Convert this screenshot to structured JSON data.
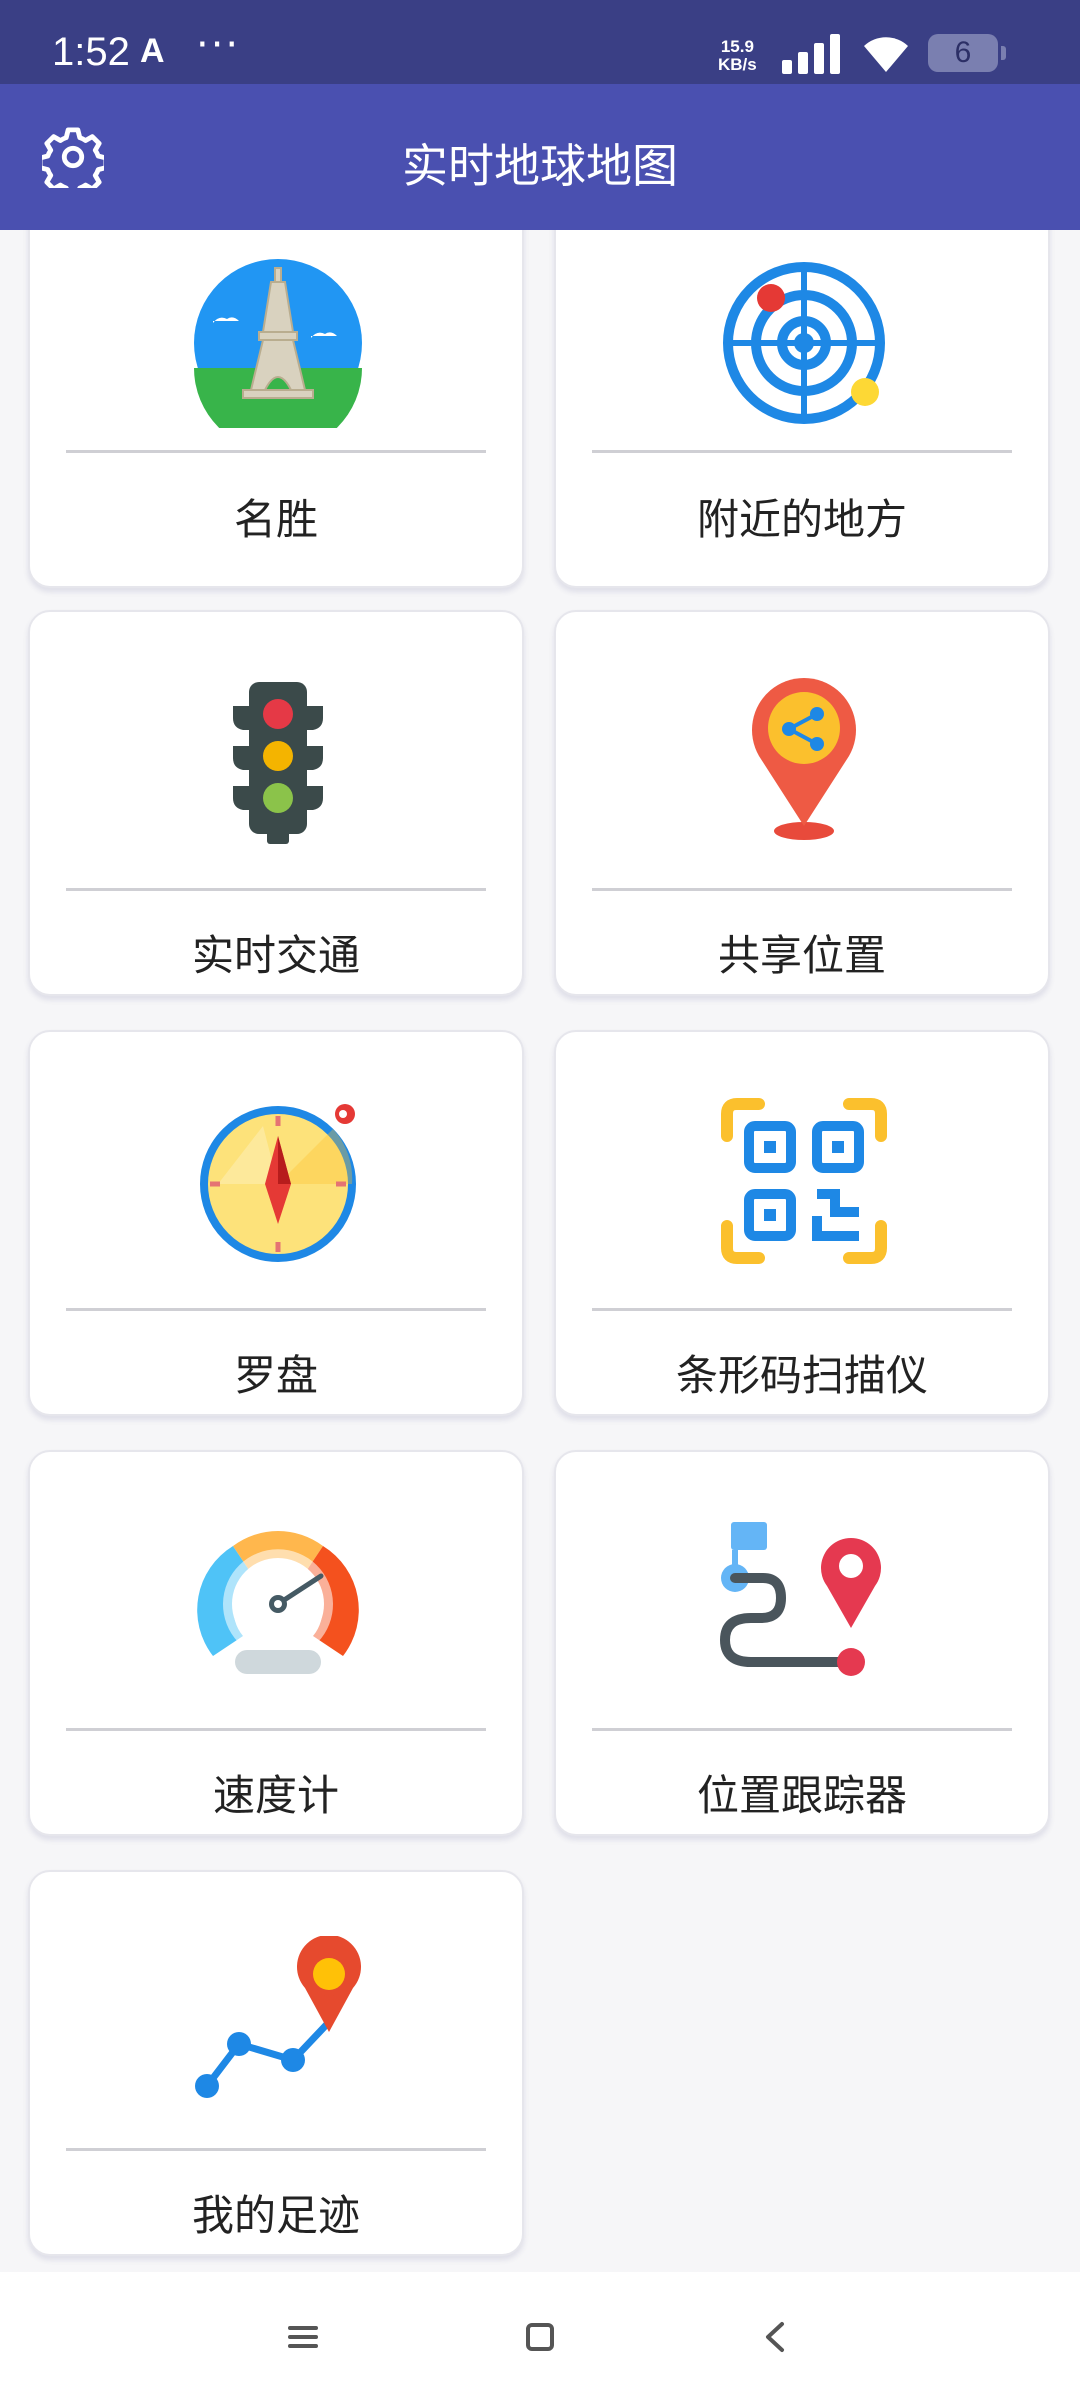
{
  "status_bar": {
    "time": "1:52",
    "a_icon": "A",
    "dots": "···",
    "speed_value": "15.9",
    "speed_unit": "KB/s",
    "battery": "6"
  },
  "app_bar": {
    "title": "实时地球地图",
    "settings_icon": "gear-icon"
  },
  "items": [
    {
      "label": "名胜",
      "icon": "eiffel-tower-icon"
    },
    {
      "label": "附近的地方",
      "icon": "radar-icon"
    },
    {
      "label": "实时交通",
      "icon": "traffic-light-icon"
    },
    {
      "label": "共享位置",
      "icon": "share-location-icon"
    },
    {
      "label": "罗盘",
      "icon": "compass-icon"
    },
    {
      "label": "条形码扫描仪",
      "icon": "qr-code-icon"
    },
    {
      "label": "速度计",
      "icon": "speedometer-icon"
    },
    {
      "label": "位置跟踪器",
      "icon": "route-tracker-icon"
    },
    {
      "label": "我的足迹",
      "icon": "footprint-path-icon"
    }
  ],
  "nav_bar": [
    "menu-icon",
    "home-icon",
    "back-icon"
  ]
}
